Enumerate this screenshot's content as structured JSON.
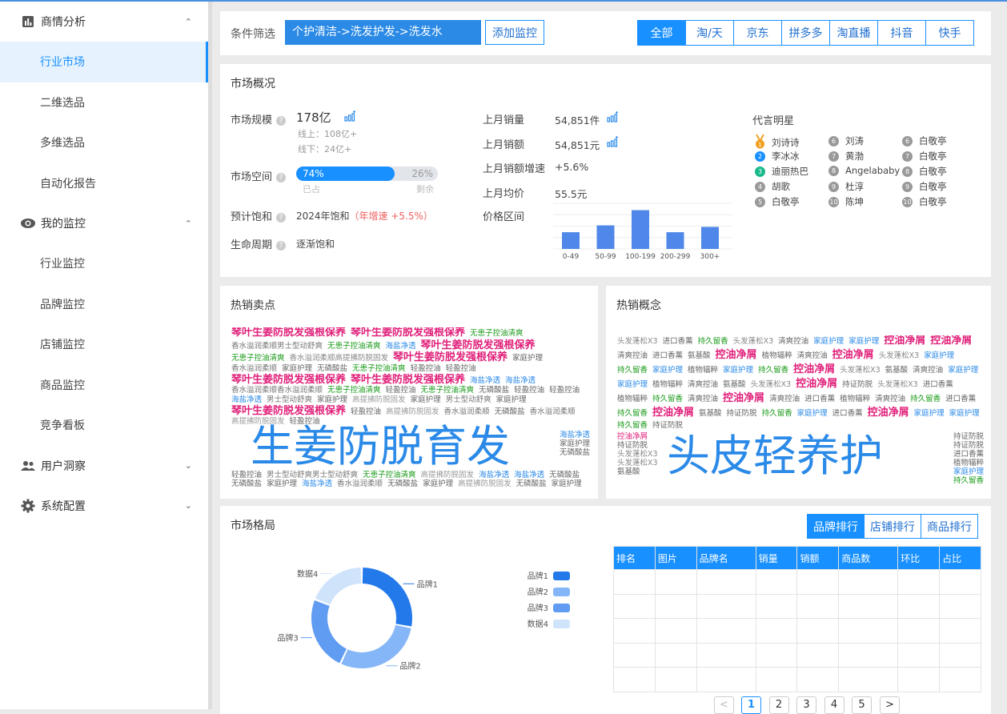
{
  "sidebar": {
    "groups": [
      {
        "label": "商情分析",
        "icon": "bar-chart-icon",
        "expanded": true,
        "items": [
          "行业市场",
          "二维选品",
          "多维选品",
          "自动化报告"
        ]
      },
      {
        "label": "我的监控",
        "icon": "eye-icon",
        "expanded": true,
        "items": [
          "行业监控",
          "品牌监控",
          "店铺监控",
          "商品监控",
          "竞争看板"
        ]
      },
      {
        "label": "用户洞察",
        "icon": "users-icon",
        "expanded": false,
        "items": []
      },
      {
        "label": "系统配置",
        "icon": "gear-icon",
        "expanded": false,
        "items": []
      }
    ],
    "active": "行业市场"
  },
  "filter": {
    "label": "条件筛选",
    "category": "个护清洁->洗发护发->洗发水",
    "add_button": "添加监控",
    "platforms": [
      "全部",
      "淘/天",
      "京东",
      "拼多多",
      "淘直播",
      "抖音",
      "快手"
    ],
    "active_platform": "全部"
  },
  "overview": {
    "title": "市场概况",
    "market_size": {
      "label": "市场规模",
      "value": "178亿",
      "online": "线上：108亿+",
      "offline": "线下：24亿+"
    },
    "market_space": {
      "label": "市场空间",
      "occupied": 74,
      "occupied_text": "74%",
      "remaining_text": "26%",
      "occupied_label": "已占",
      "remaining_label": "剩余"
    },
    "saturation": {
      "label": "预计饱和",
      "value": "2024年饱和",
      "growth": "（年增速 +5.5%）"
    },
    "lifecycle": {
      "label": "生命周期",
      "value": "逐渐饱和"
    },
    "metrics": [
      {
        "label": "上月销量",
        "value": "54,851件",
        "trend_icon": true
      },
      {
        "label": "上月销额",
        "value": "54,851元",
        "trend_icon": true
      },
      {
        "label": "上月销额增速",
        "value": "+5.6%"
      },
      {
        "label": "上月均价",
        "value": "55.5元"
      }
    ],
    "price_range_label": "价格区间",
    "celebrities_title": "代言明星",
    "celebrities": [
      [
        "刘诗诗",
        "李冰冰",
        "迪丽热巴",
        "胡歌",
        "白敬亭"
      ],
      [
        "刘涛",
        "黄渤",
        "Angelababy",
        "杜淳",
        "陈坤"
      ],
      [
        "白敬亭",
        "白敬亭",
        "白敬亭",
        "白敬亭",
        "白敬亭"
      ]
    ],
    "rank_colors": {
      "1": "#f0a020",
      "2": "#1890ff",
      "3": "#19b98a",
      "default": "#999999"
    }
  },
  "chart_data": [
    {
      "type": "bar",
      "categories": [
        "0-49",
        "50-99",
        "100-199",
        "200-299",
        "300+"
      ],
      "values": [
        22,
        31,
        51,
        22,
        29
      ],
      "ylim": [
        0,
        60
      ],
      "grid": true,
      "color": "#4f88e8"
    },
    {
      "type": "pie",
      "variant": "donut",
      "categories": [
        "品牌1",
        "品牌2",
        "品牌3",
        "数据4"
      ],
      "values": [
        28,
        29,
        24,
        19
      ],
      "colors": [
        "#2479ea",
        "#85b6f7",
        "#5f9cf2",
        "#cfe4fb"
      ],
      "legend": "right"
    }
  ],
  "hot_points": {
    "title": "热销卖点",
    "main": "生姜防脱育发",
    "words": [
      [
        "琴叶生姜防脱发强根保养",
        "m",
        "#e0207a"
      ],
      [
        "琴叶生姜防脱发强根保养",
        "m",
        "#e0207a"
      ],
      [
        "无患子控油清爽",
        "s",
        "#1a9a1a"
      ],
      [
        "香水溢润柔顺男士型动舒爽",
        "s",
        "#777"
      ],
      [
        "无患子控油清爽",
        "s",
        "#1a9a1a"
      ],
      [
        "海盐净透",
        "s",
        "#2b8ae8"
      ],
      [
        "琴叶生姜防脱发强根保养",
        "m",
        "#e0207a"
      ],
      [
        "无患子控油清爽",
        "s",
        "#1a9a1a"
      ],
      [
        "香水溢润柔顺高提拂防脱固发",
        "s",
        "#888"
      ],
      [
        "琴叶生姜防脱发强根保养",
        "m",
        "#e0207a"
      ],
      [
        "家庭护理",
        "s",
        "#666"
      ],
      [
        "香水溢润柔顺",
        "s",
        "#777"
      ],
      [
        "家庭护理",
        "s",
        "#666"
      ],
      [
        "无磷酸盐",
        "s",
        "#666"
      ],
      [
        "无患子控油清爽",
        "s",
        "#1a9a1a"
      ],
      [
        "轻盈控油",
        "s",
        "#666"
      ],
      [
        "轻盈控油",
        "s",
        "#666"
      ],
      [
        "琴叶生姜防脱发强根保养",
        "m",
        "#e0207a"
      ],
      [
        "琴叶生姜防脱发强根保养",
        "m",
        "#e0207a"
      ],
      [
        "海盐净透",
        "s",
        "#2b8ae8"
      ],
      [
        "海盐净透",
        "s",
        "#2b8ae8"
      ],
      [
        "香水溢润柔顺香水溢润柔顺",
        "s",
        "#777"
      ],
      [
        "无患子控油清爽",
        "s",
        "#1a9a1a"
      ],
      [
        "轻盈控油",
        "s",
        "#666"
      ],
      [
        "无患子控油清爽",
        "s",
        "#1a9a1a"
      ],
      [
        "无磷酸盐",
        "s",
        "#666"
      ],
      [
        "轻盈控油",
        "s",
        "#666"
      ],
      [
        "轻盈控油",
        "s",
        "#666"
      ],
      [
        "海盐净透",
        "s",
        "#2b8ae8"
      ],
      [
        "男士型动舒爽",
        "s",
        "#777"
      ],
      [
        "家庭护理",
        "s",
        "#666"
      ],
      [
        "高提拂防脱固发",
        "s",
        "#999"
      ],
      [
        "家庭护理",
        "s",
        "#666"
      ],
      [
        "男士型动舒爽",
        "s",
        "#777"
      ],
      [
        "家庭护理",
        "s",
        "#666"
      ],
      [
        "琴叶生姜防脱发强根保养",
        "m",
        "#e0207a"
      ],
      [
        "轻盈控油",
        "s",
        "#666"
      ],
      [
        "高提拂防脱固发",
        "s",
        "#999"
      ],
      [
        "香水溢润柔顺",
        "s",
        "#777"
      ],
      [
        "无磷酸盐",
        "s",
        "#666"
      ],
      [
        "香水溢润柔顺",
        "s",
        "#777"
      ],
      [
        "高提拂防脱固发",
        "s",
        "#999"
      ],
      [
        "轻盈控油",
        "s",
        "#666"
      ]
    ],
    "side_words": [
      [
        "海盐净透",
        "s",
        "#2b8ae8"
      ],
      [
        "家庭护理",
        "s",
        "#666"
      ],
      [
        "无磷酸盐",
        "s",
        "#666"
      ]
    ],
    "bottom_words": [
      [
        "轻盈控油",
        "s",
        "#666"
      ],
      [
        "男士型动舒爽男士型动舒爽",
        "s",
        "#777"
      ],
      [
        "无患子控油清爽",
        "s",
        "#1a9a1a"
      ],
      [
        "高提拂防脱固发",
        "s",
        "#999"
      ],
      [
        "海盐净透",
        "s",
        "#2b8ae8"
      ],
      [
        "海盐净透",
        "s",
        "#2b8ae8"
      ],
      [
        "无磷酸盐",
        "s",
        "#666"
      ],
      [
        "无磷酸盐",
        "s",
        "#666"
      ],
      [
        "家庭护理",
        "s",
        "#666"
      ],
      [
        "海盐净透",
        "s",
        "#2b8ae8"
      ],
      [
        "香水溢润柔顺",
        "s",
        "#777"
      ],
      [
        "无磷酸盐",
        "s",
        "#666"
      ],
      [
        "家庭护理",
        "s",
        "#666"
      ],
      [
        "高提拂防脱固发",
        "s",
        "#999"
      ],
      [
        "无磷酸盐",
        "s",
        "#666"
      ],
      [
        "家庭护理",
        "s",
        "#666"
      ]
    ]
  },
  "hot_concepts": {
    "title": "热销概念",
    "main": "头皮轻养护",
    "words": [
      [
        "头发蓬松X3",
        "s",
        "#888"
      ],
      [
        "进口香薰",
        "s",
        "#666"
      ],
      [
        "持久留香",
        "s",
        "#1a9a1a"
      ],
      [
        "头发蓬松X3",
        "s",
        "#888"
      ],
      [
        "清爽控油",
        "s",
        "#666"
      ],
      [
        "家庭护理",
        "s",
        "#2b8ae8"
      ],
      [
        "家庭护理",
        "s",
        "#2b8ae8"
      ],
      [
        "控油净屑",
        "m",
        "#e0207a"
      ],
      [
        "控油净屑",
        "m",
        "#e0207a"
      ],
      [
        "清爽控油",
        "s",
        "#666"
      ],
      [
        "进口香薰",
        "s",
        "#666"
      ],
      [
        "氨基酸",
        "s",
        "#666"
      ],
      [
        "控油净屑",
        "m",
        "#e0207a"
      ],
      [
        "植物辐粹",
        "s",
        "#666"
      ],
      [
        "清爽控油",
        "s",
        "#666"
      ],
      [
        "控油净屑",
        "m",
        "#e0207a"
      ],
      [
        "头发蓬松X3",
        "s",
        "#888"
      ],
      [
        "家庭护理",
        "s",
        "#2b8ae8"
      ],
      [
        "持久留香",
        "s",
        "#1a9a1a"
      ],
      [
        "家庭护理",
        "s",
        "#2b8ae8"
      ],
      [
        "植物辐粹",
        "s",
        "#666"
      ],
      [
        "家庭护理",
        "s",
        "#2b8ae8"
      ],
      [
        "持久留香",
        "s",
        "#1a9a1a"
      ],
      [
        "控油净屑",
        "m",
        "#e0207a"
      ],
      [
        "头发蓬松X3",
        "s",
        "#888"
      ],
      [
        "氨基酸",
        "s",
        "#666"
      ],
      [
        "清爽控油",
        "s",
        "#666"
      ],
      [
        "家庭护理",
        "s",
        "#2b8ae8"
      ],
      [
        "家庭护理",
        "s",
        "#2b8ae8"
      ],
      [
        "植物辐粹",
        "s",
        "#666"
      ],
      [
        "清爽控油",
        "s",
        "#666"
      ],
      [
        "氨基酸",
        "s",
        "#666"
      ],
      [
        "头发蓬松X3",
        "s",
        "#888"
      ],
      [
        "控油净屑",
        "m",
        "#e0207a"
      ],
      [
        "持证防脱",
        "s",
        "#666"
      ],
      [
        "头发蓬松X3",
        "s",
        "#888"
      ],
      [
        "进口香薰",
        "s",
        "#666"
      ],
      [
        "植物辐粹",
        "s",
        "#666"
      ],
      [
        "持久留香",
        "s",
        "#1a9a1a"
      ],
      [
        "清爽控油",
        "s",
        "#666"
      ],
      [
        "控油净屑",
        "m",
        "#e0207a"
      ],
      [
        "清爽控油",
        "s",
        "#666"
      ],
      [
        "进口香薰",
        "s",
        "#666"
      ],
      [
        "植物辐粹",
        "s",
        "#666"
      ],
      [
        "清爽控油",
        "s",
        "#666"
      ],
      [
        "持久留香",
        "s",
        "#1a9a1a"
      ],
      [
        "进口香薰",
        "s",
        "#666"
      ],
      [
        "持久留香",
        "s",
        "#1a9a1a"
      ],
      [
        "控油净屑",
        "m",
        "#e0207a"
      ],
      [
        "氨基酸",
        "s",
        "#666"
      ],
      [
        "持证防脱",
        "s",
        "#666"
      ],
      [
        "持久留香",
        "s",
        "#1a9a1a"
      ],
      [
        "家庭护理",
        "s",
        "#2b8ae8"
      ],
      [
        "进口香薰",
        "s",
        "#666"
      ],
      [
        "控油净屑",
        "m",
        "#e0207a"
      ],
      [
        "家庭护理",
        "s",
        "#2b8ae8"
      ],
      [
        "家庭护理",
        "s",
        "#2b8ae8"
      ],
      [
        "持久留香",
        "s",
        "#1a9a1a"
      ],
      [
        "持证防脱",
        "s",
        "#666"
      ]
    ],
    "side_words": [
      [
        "持证防脱",
        "s",
        "#666"
      ],
      [
        "持证防脱",
        "s",
        "#666"
      ],
      [
        "进口香薰",
        "s",
        "#666"
      ],
      [
        "植物辐粹",
        "s",
        "#666"
      ],
      [
        "家庭护理",
        "s",
        "#2b8ae8"
      ],
      [
        "持久留香",
        "s",
        "#1a9a1a"
      ]
    ],
    "left_words": [
      [
        "控油净屑",
        "s",
        "#e0207a"
      ],
      [
        "持证防脱",
        "s",
        "#666"
      ],
      [
        "头发蓬松X3",
        "s",
        "#888"
      ],
      [
        "头发蓬松X3",
        "s",
        "#888"
      ],
      [
        "氨基酸",
        "s",
        "#666"
      ]
    ]
  },
  "market_pattern": {
    "title": "市场格局",
    "tabs": [
      "品牌排行",
      "店铺排行",
      "商品排行"
    ],
    "active_tab": "品牌排行",
    "table": {
      "columns": [
        "排名",
        "图片",
        "品牌名",
        "销量",
        "销额",
        "商品数",
        "环比",
        "占比"
      ],
      "rows": 5
    },
    "pagination": {
      "pages": [
        "1",
        "2",
        "3",
        "4",
        "5"
      ],
      "current": "1",
      "prev": "<",
      "next": ">"
    }
  }
}
